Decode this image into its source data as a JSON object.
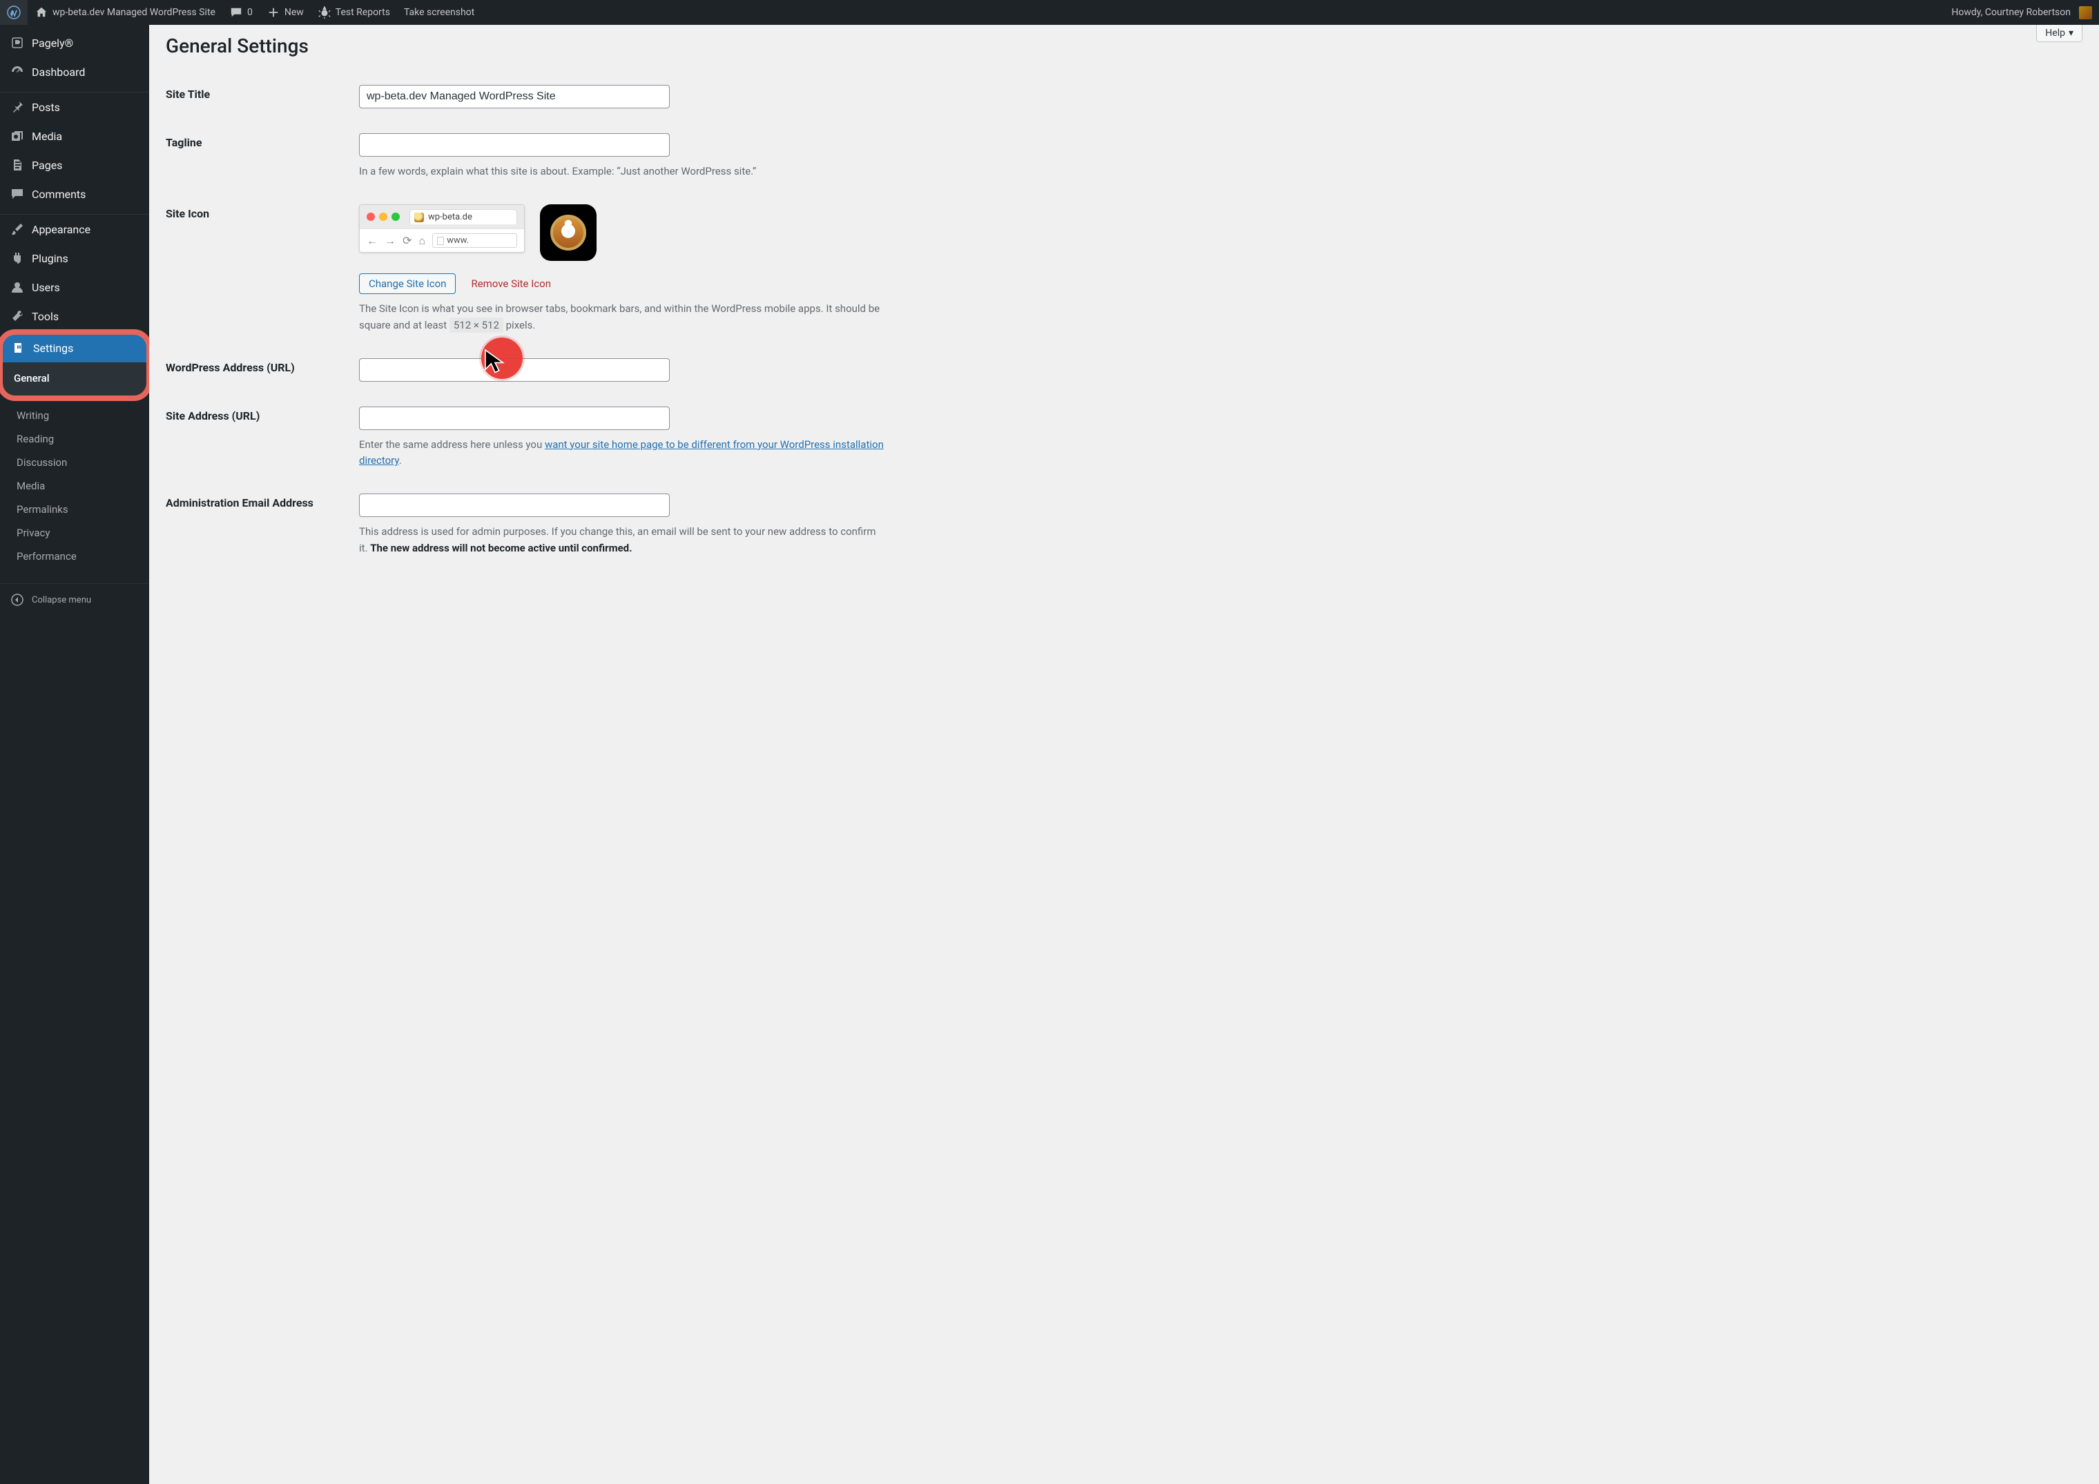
{
  "adminbar": {
    "site_name": "wp-beta.dev Managed WordPress Site",
    "comments_count": "0",
    "new_label": "New",
    "extra1": "Test Reports",
    "extra2": "Take screenshot",
    "howdy": "Howdy, Courtney Robertson"
  },
  "help_tab": "Help",
  "page_title": "General Settings",
  "sidebar": {
    "items": [
      {
        "label": "Pagely®"
      },
      {
        "label": "Dashboard"
      },
      {
        "label": "Posts"
      },
      {
        "label": "Media"
      },
      {
        "label": "Pages"
      },
      {
        "label": "Comments"
      },
      {
        "label": "Appearance"
      },
      {
        "label": "Plugins"
      },
      {
        "label": "Users"
      },
      {
        "label": "Tools"
      },
      {
        "label": "Settings"
      }
    ],
    "submenu": {
      "current": "General",
      "rest": [
        {
          "label": "Writing"
        },
        {
          "label": "Reading"
        },
        {
          "label": "Discussion"
        },
        {
          "label": "Media"
        },
        {
          "label": "Permalinks"
        },
        {
          "label": "Privacy"
        },
        {
          "label": "Performance"
        }
      ]
    },
    "collapse": "Collapse menu"
  },
  "fields": {
    "site_title": {
      "label": "Site Title",
      "value": "wp-beta.dev Managed WordPress Site"
    },
    "tagline": {
      "label": "Tagline",
      "value": "",
      "help": "In a few words, explain what this site is about. Example: “Just another WordPress site.”"
    },
    "site_icon": {
      "label": "Site Icon",
      "tab_text": "wp-beta.de",
      "url_text": "www.",
      "change_button": "Change Site Icon",
      "remove_button": "Remove Site Icon",
      "help_before_px": "The Site Icon is what you see in browser tabs, bookmark bars, and within the WordPress mobile apps. It should be square and at least ",
      "px": "512 × 512",
      "help_after_px": " pixels."
    },
    "wp_url": {
      "label": "WordPress Address (URL)",
      "value": ""
    },
    "site_url": {
      "label": "Site Address (URL)",
      "value": "",
      "help_plain": "Enter the same address here unless you ",
      "help_link": "want your site home page to be different from your WordPress installation directory",
      "help_after": "."
    },
    "admin_email": {
      "label": "Administration Email Address",
      "value": "",
      "help_plain": "This address is used for admin purposes. If you change this, an email will be sent to your new address to confirm it. ",
      "help_strong": "The new address will not become active until confirmed."
    }
  }
}
